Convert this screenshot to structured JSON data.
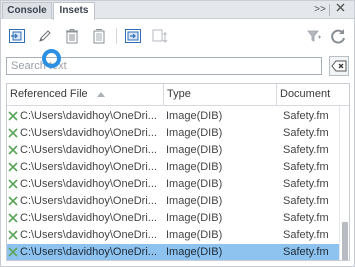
{
  "tabs": [
    {
      "label": "Console"
    },
    {
      "label": "Insets"
    }
  ],
  "tabbar": {
    "more_label": ">>"
  },
  "toolbar": {
    "icons": [
      "place-inset-icon",
      "edit-inset-icon",
      "delete-inset-icon",
      "convert-inset-icon",
      "goto-inset-icon",
      "update-inset-icon",
      "filter-icon",
      "refresh-icon"
    ]
  },
  "search": {
    "placeholder": "Search text",
    "value": ""
  },
  "table": {
    "columns": [
      "Referenced File",
      "Type",
      "Document"
    ],
    "rows": [
      {
        "file": "C:\\Users\\davidhoy\\OneDri...",
        "type": "Image(DIB)",
        "doc": "Safety.fm"
      },
      {
        "file": "C:\\Users\\davidhoy\\OneDri...",
        "type": "Image(DIB)",
        "doc": "Safety.fm"
      },
      {
        "file": "C:\\Users\\davidhoy\\OneDri...",
        "type": "Image(DIB)",
        "doc": "Safety.fm"
      },
      {
        "file": "C:\\Users\\davidhoy\\OneDri...",
        "type": "Image(DIB)",
        "doc": "Safety.fm"
      },
      {
        "file": "C:\\Users\\davidhoy\\OneDri...",
        "type": "Image(DIB)",
        "doc": "Safety.fm"
      },
      {
        "file": "C:\\Users\\davidhoy\\OneDri...",
        "type": "Image(DIB)",
        "doc": "Safety.fm"
      },
      {
        "file": "C:\\Users\\davidhoy\\OneDri...",
        "type": "Image(DIB)",
        "doc": "Safety.fm"
      },
      {
        "file": "C:\\Users\\davidhoy\\OneDri...",
        "type": "Image(DIB)",
        "doc": "Safety.fm"
      },
      {
        "file": "C:\\Users\\davidhoy\\OneDri...",
        "type": "Image(DIB)",
        "doc": "Safety.fm"
      }
    ],
    "selected_row": 8
  },
  "colors": {
    "accent": "#2b8fe3",
    "selection": "#8fc3ef",
    "row_icon": "#5aa55a"
  }
}
